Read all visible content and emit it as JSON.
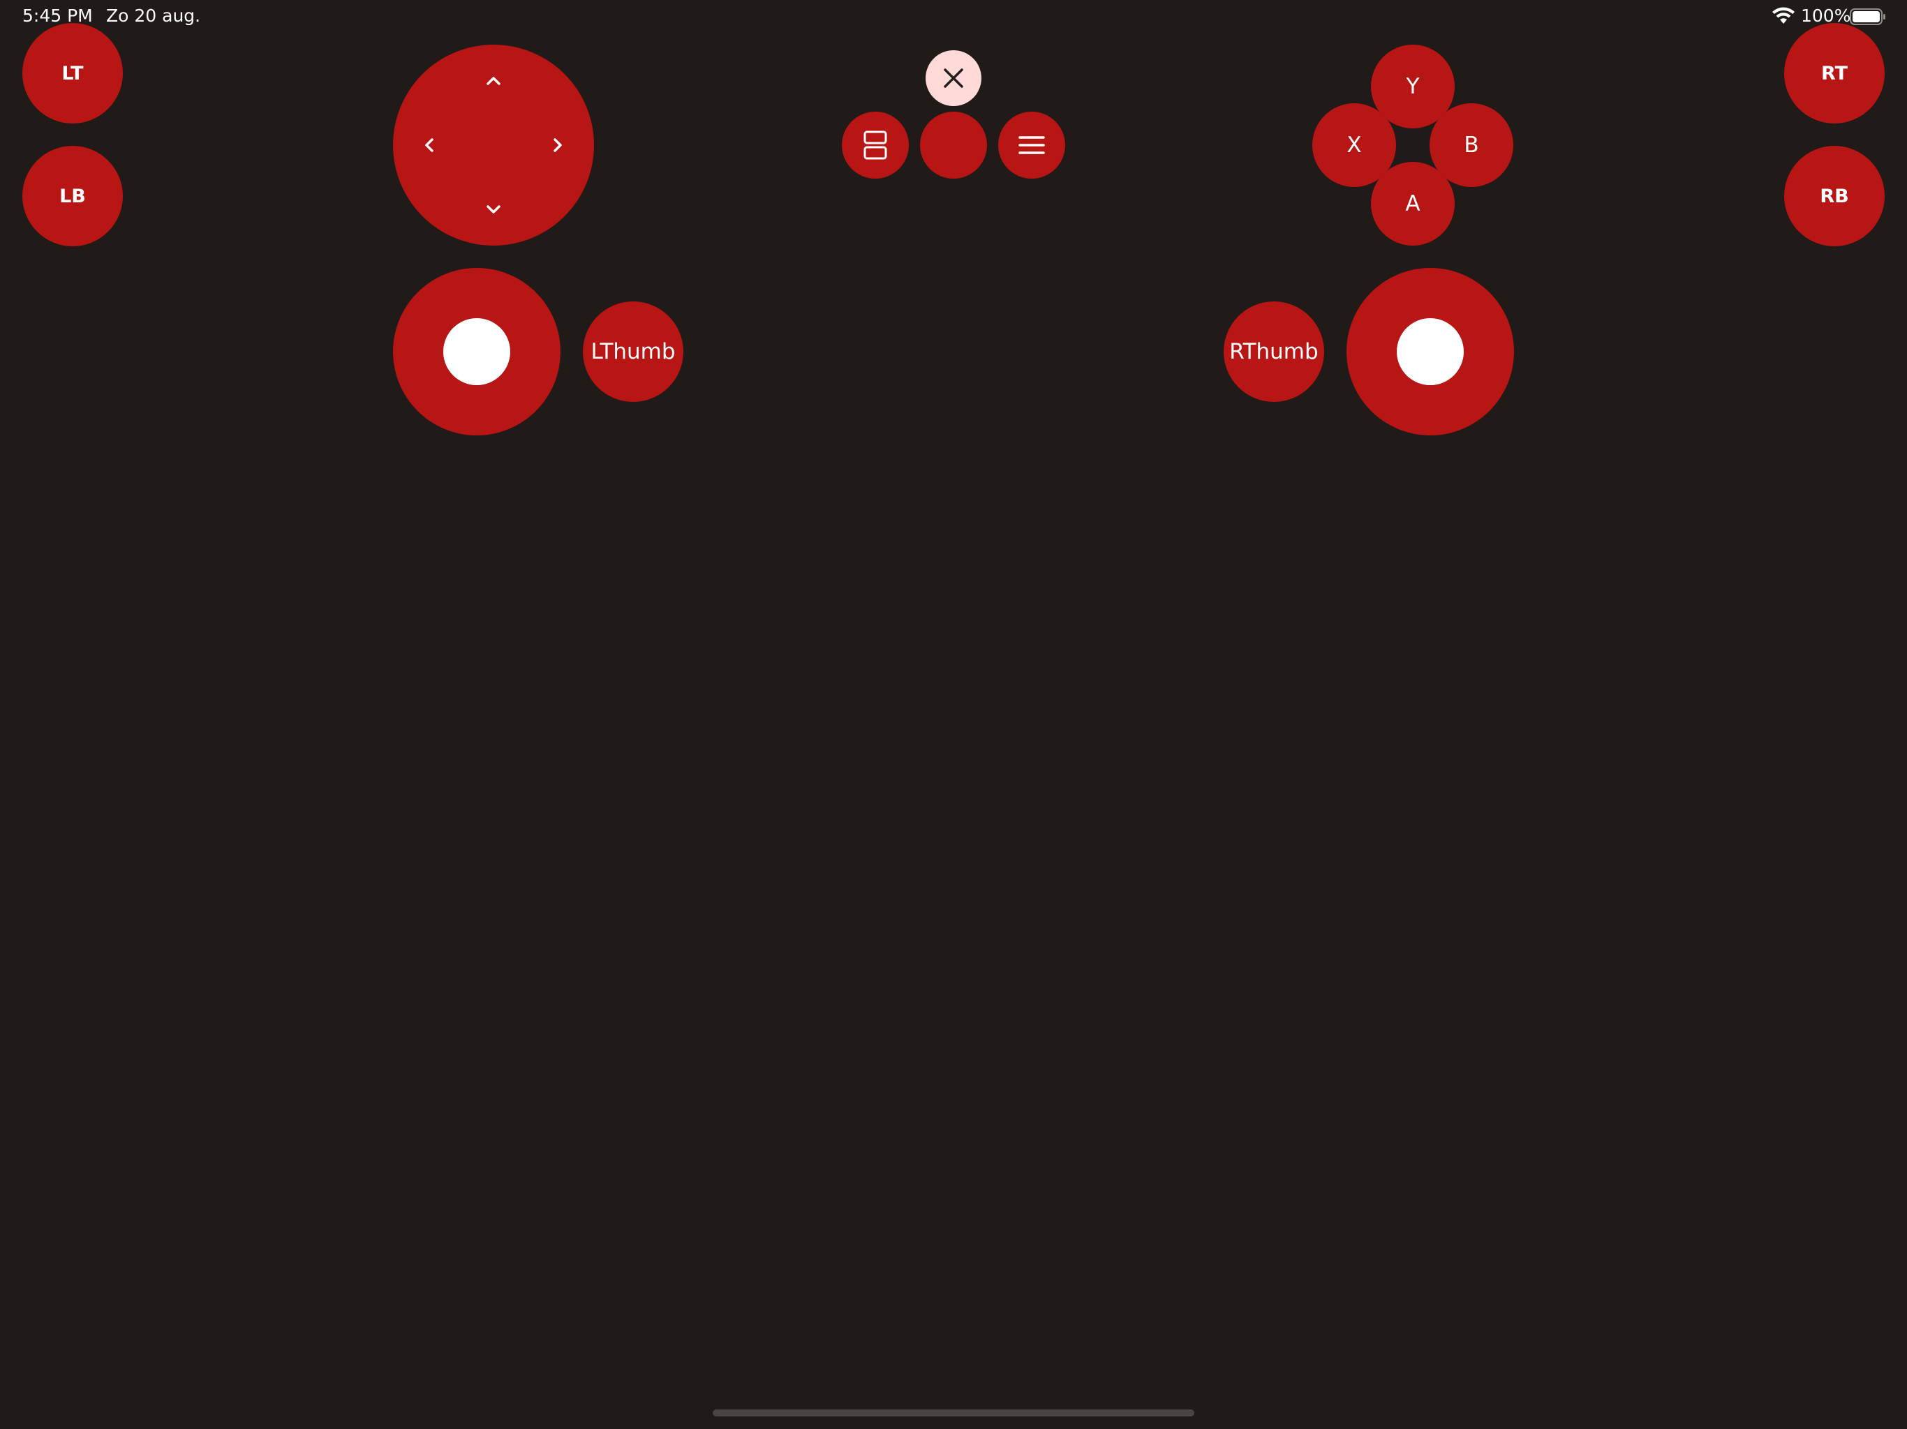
{
  "status_bar": {
    "time": "5:45 PM",
    "date": "Zo 20 aug.",
    "battery_percent": "100%",
    "battery_level": 1.0,
    "icons": [
      "wifi-icon",
      "battery-icon"
    ]
  },
  "colors": {
    "background": "#201a19",
    "button": "#b81515",
    "close_button": "#ffdad6",
    "label": "#ffffff",
    "stick_knob": "#ffffff",
    "home_indicator": "#4a4544"
  },
  "shoulder_buttons": {
    "lt": "LT",
    "lb": "LB",
    "rt": "RT",
    "rb": "RB"
  },
  "dpad": {
    "icons": [
      "chevron-up-icon",
      "chevron-down-icon",
      "chevron-left-icon",
      "chevron-right-icon"
    ]
  },
  "center_controls": {
    "icons": [
      "close-icon",
      "view-icon",
      "guide-button",
      "menu-icon"
    ]
  },
  "face_buttons": {
    "y": "Y",
    "x": "X",
    "b": "B",
    "a": "A"
  },
  "thumb_buttons": {
    "left": "LThumb",
    "right": "RThumb"
  }
}
